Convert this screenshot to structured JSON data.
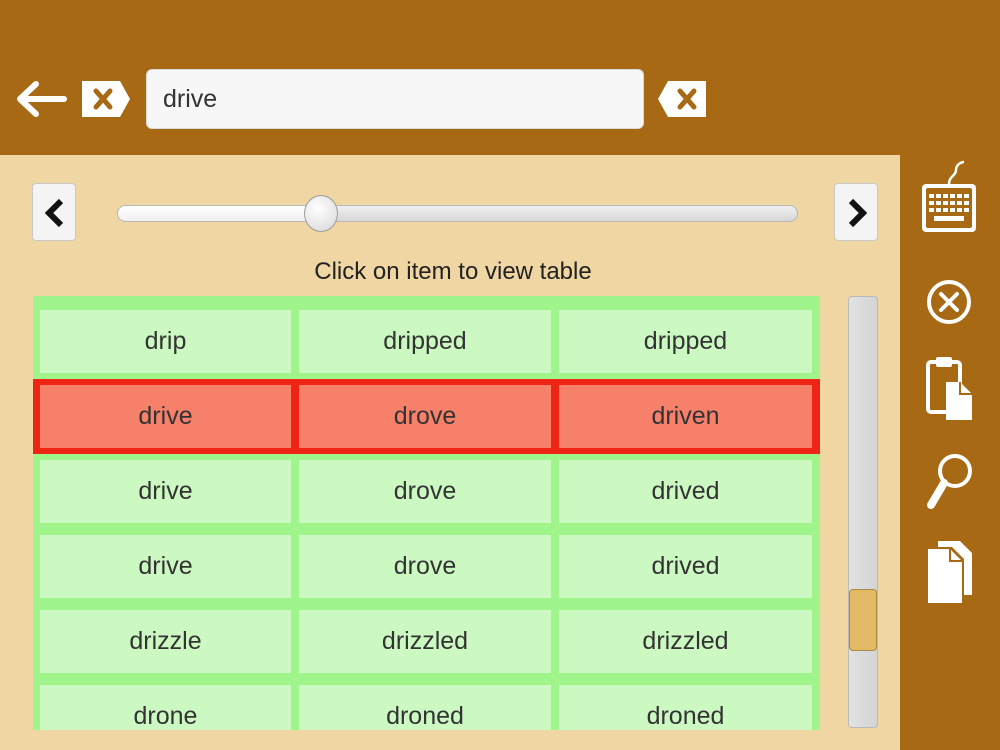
{
  "search": {
    "value": "drive"
  },
  "slider": {
    "value": 0.3
  },
  "hint": "Click on item to view table",
  "rows": [
    {
      "cells": [
        "drip",
        "dripped",
        "dripped"
      ],
      "selected": false
    },
    {
      "cells": [
        "drive",
        "drove",
        "driven"
      ],
      "selected": true
    },
    {
      "cells": [
        "drive",
        "drove",
        "drived"
      ],
      "selected": false
    },
    {
      "cells": [
        "drive",
        "drove",
        "drived"
      ],
      "selected": false
    },
    {
      "cells": [
        "drizzle",
        "drizzled",
        "drizzled"
      ],
      "selected": false
    },
    {
      "cells": [
        "drone",
        "droned",
        "droned"
      ],
      "selected": false
    }
  ],
  "colors": {
    "brand": "#a86914",
    "panel": "#efd6a2",
    "row_border": "#9ff58c",
    "row_fill": "#ccf9c2",
    "selected_border": "#ee2514",
    "selected_fill": "#f7806b",
    "scroll_thumb": "#e2b964"
  },
  "icons": {
    "back": "arrow-left-icon",
    "clear": "backspace-x-icon",
    "prev": "chevron-left-icon",
    "next": "chevron-right-icon",
    "keyboard": "keyboard-icon",
    "close": "circle-x-icon",
    "paste": "clipboard-paste-icon",
    "search": "magnifier-icon",
    "copy": "copy-pages-icon"
  }
}
